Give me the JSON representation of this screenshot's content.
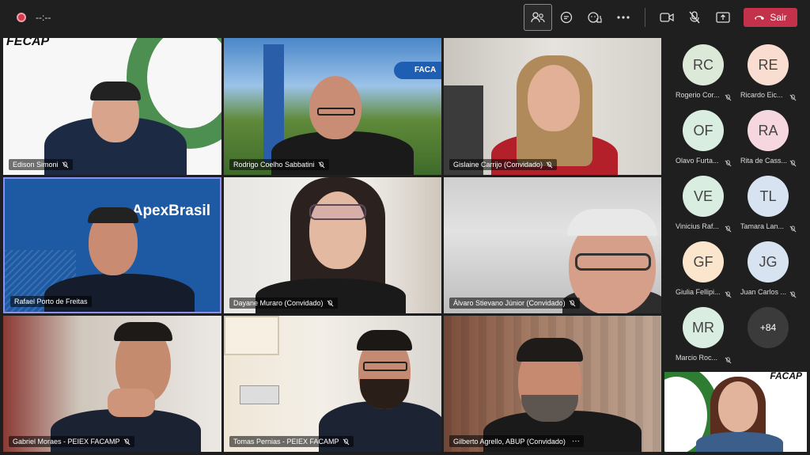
{
  "toolbar": {
    "timer": "--:--",
    "leave_label": "Sair",
    "colors": {
      "leave": "#c4314b",
      "record": "#d6394c"
    }
  },
  "tiles": [
    {
      "name": "Edison Simoni",
      "logo": "FECAP"
    },
    {
      "name": "Rodrigo Coelho Sabbatini",
      "logo": "FACA"
    },
    {
      "name": "Gislaine Carrijo (Convidado)"
    },
    {
      "name": "Rafael Porto de Freitas",
      "logo": "ApexBrasil"
    },
    {
      "name": "Dayane Muraro (Convidado)"
    },
    {
      "name": "Álvaro Stievano Júnior (Convidado)"
    },
    {
      "name": "Gabriel Moraes - PEIEX FACAMP"
    },
    {
      "name": "Tomas Pernias - PEIEX FACAMP"
    },
    {
      "name": "Gilberto Agrello, ABUP (Convidado)",
      "more": "···"
    }
  ],
  "roster": [
    {
      "initials": "RC",
      "name": "Rogerio Cor...",
      "color": "#dde9d8"
    },
    {
      "initials": "RE",
      "name": "Ricardo Eic...",
      "color": "#f9ddd0"
    },
    {
      "initials": "OF",
      "name": "Olavo Furta...",
      "color": "#d9ede1"
    },
    {
      "initials": "RA",
      "name": "Rita de Cass...",
      "color": "#f6d7e0"
    },
    {
      "initials": "VE",
      "name": "Vinicius Raf...",
      "color": "#d9ede1"
    },
    {
      "initials": "TL",
      "name": "Tamara Lan...",
      "color": "#d8e3f2"
    },
    {
      "initials": "GF",
      "name": "Giulia Fellipi...",
      "color": "#fbe6cd"
    },
    {
      "initials": "JG",
      "name": "Juan Carlos ...",
      "color": "#d8e3f2"
    },
    {
      "initials": "MR",
      "name": "Marcio Roc...",
      "color": "#d9ede1"
    },
    {
      "initials": "+84",
      "name": ""
    }
  ],
  "self_view": {
    "logo": "FACAP"
  }
}
